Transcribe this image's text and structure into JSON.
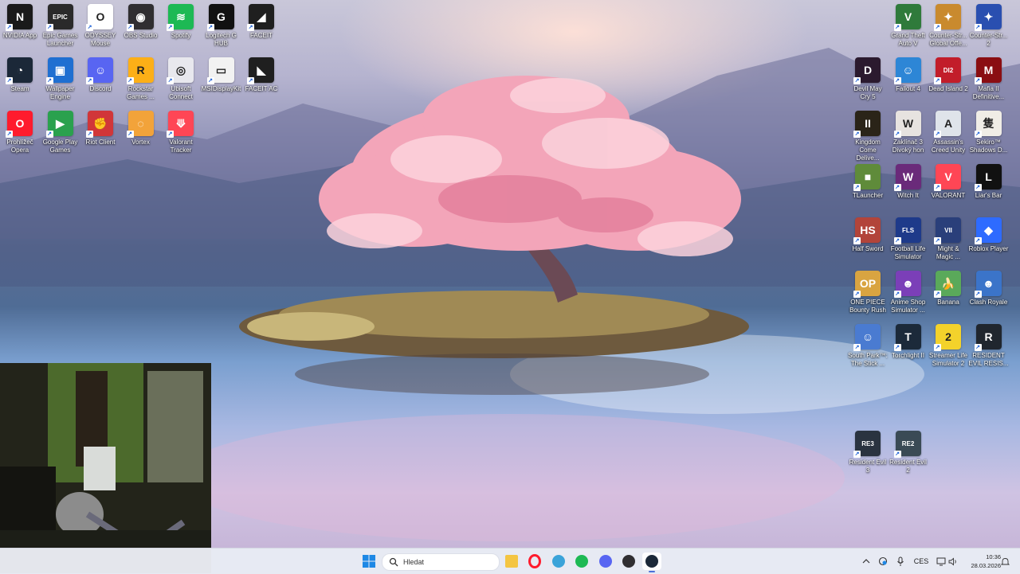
{
  "desktop_icons_left": [
    {
      "label": "NVIDIA App",
      "icon": "nvidia-icon",
      "color": "#1a1a1a",
      "glyph": "N"
    },
    {
      "label": "Epic Games\nLauncher",
      "icon": "epic-games-icon",
      "color": "#2a2a2a",
      "glyph": "EPIC"
    },
    {
      "label": "ODYSSEY\nMouse",
      "icon": "odyssey-mouse-icon",
      "color": "#ffffff",
      "glyph": "O"
    },
    {
      "label": "OBS Studio",
      "icon": "obs-icon",
      "color": "#302e31",
      "glyph": "◉"
    },
    {
      "label": "Spotify",
      "icon": "spotify-icon",
      "color": "#1db954",
      "glyph": "≋"
    },
    {
      "label": "Logitech G\nHUB",
      "icon": "logitech-icon",
      "color": "#111111",
      "glyph": "G"
    },
    {
      "label": "FACEIT",
      "icon": "faceit-icon",
      "color": "#1f1f1f",
      "glyph": "◢"
    },
    {
      "label": "Steam",
      "icon": "steam-icon",
      "color": "#1b2838",
      "glyph": "◔"
    },
    {
      "label": "Wallpaper\nEngine",
      "icon": "wallpaper-engine-icon",
      "color": "#1f6fd1",
      "glyph": "▣"
    },
    {
      "label": "Discord",
      "icon": "discord-icon",
      "color": "#5865f2",
      "glyph": "☺"
    },
    {
      "label": "Rockstar\nGames ...",
      "icon": "rockstar-icon",
      "color": "#fcaf17",
      "glyph": "R"
    },
    {
      "label": "Ubisoft\nConnect",
      "icon": "ubisoft-icon",
      "color": "#e8e8ee",
      "glyph": "◎"
    },
    {
      "label": "MSIDisplayKit",
      "icon": "msi-displaykit-icon",
      "color": "#f2f2f2",
      "glyph": "▭"
    },
    {
      "label": "FACEIT AC",
      "icon": "faceit-ac-icon",
      "color": "#1f1f1f",
      "glyph": "◣"
    },
    {
      "label": "Prohlížeč\nOpera",
      "icon": "opera-icon",
      "color": "#ff1b2d",
      "glyph": "O"
    },
    {
      "label": "Google Play\nGames",
      "icon": "google-play-games-icon",
      "color": "#2aa14e",
      "glyph": "▶"
    },
    {
      "label": "Riot Client",
      "icon": "riot-client-icon",
      "color": "#d13639",
      "glyph": "✊"
    },
    {
      "label": "Vortex",
      "icon": "vortex-icon",
      "color": "#f2a33a",
      "glyph": "◌"
    },
    {
      "label": "Valorant\nTracker",
      "icon": "valorant-tracker-icon",
      "color": "#ff4655",
      "glyph": "⟱"
    }
  ],
  "desktop_icons_right": [
    {
      "label": "Grand Theft\nAuto V",
      "icon": "gta-v-icon",
      "color": "#2f7a3b",
      "glyph": "V"
    },
    {
      "label": "Counter-Str...\nGlobal Offe...",
      "icon": "csgo-icon",
      "color": "#c98a2e",
      "glyph": "✦"
    },
    {
      "label": "Counter-Str...\n2",
      "icon": "cs2-icon",
      "color": "#2a4fb0",
      "glyph": "✦"
    },
    {
      "label": "Devil May\nCry 5",
      "icon": "devil-may-cry-icon",
      "color": "#2b1a2e",
      "glyph": "D"
    },
    {
      "label": "Fallout 4",
      "icon": "fallout-4-icon",
      "color": "#2d86d6",
      "glyph": "☺"
    },
    {
      "label": "Dead Island 2",
      "icon": "dead-island-icon",
      "color": "#c21d2a",
      "glyph": "DI2"
    },
    {
      "label": "Mafia II\nDefinitive...",
      "icon": "mafia-icon",
      "color": "#8a0e12",
      "glyph": "M"
    },
    {
      "label": "Kingdom\nCome Delive...",
      "icon": "kingdom-come-icon",
      "color": "#2a2418",
      "glyph": "II"
    },
    {
      "label": "Zaklínač 3\nDivoký hon",
      "icon": "witcher-3-icon",
      "color": "#e7e3e0",
      "glyph": "W"
    },
    {
      "label": "Assassin's\nCreed Unity",
      "icon": "assassins-creed-icon",
      "color": "#dfe4ea",
      "glyph": "A"
    },
    {
      "label": "Sekiro™\nShadows D...",
      "icon": "sekiro-icon",
      "color": "#f0ede6",
      "glyph": "隻"
    },
    {
      "label": "TLauncher",
      "icon": "tlauncher-icon",
      "color": "#5f8b3a",
      "glyph": "■"
    },
    {
      "label": "Witch It",
      "icon": "witch-it-icon",
      "color": "#6a2a7a",
      "glyph": "W"
    },
    {
      "label": "VALORANT",
      "icon": "valorant-icon",
      "color": "#ff4655",
      "glyph": "V"
    },
    {
      "label": "Liar's Bar",
      "icon": "liars-bar-icon",
      "color": "#111111",
      "glyph": "L"
    },
    {
      "label": "Half Sword",
      "icon": "half-sword-icon",
      "color": "#b2443a",
      "glyph": "HS"
    },
    {
      "label": "Football Life\nSimulator",
      "icon": "football-life-icon",
      "color": "#1e3a8a",
      "glyph": "FLS"
    },
    {
      "label": "Might &\nMagic ...",
      "icon": "might-magic-icon",
      "color": "#2a3f7a",
      "glyph": "VII"
    },
    {
      "label": "Roblox Player",
      "icon": "roblox-icon",
      "color": "#2e6bff",
      "glyph": "◆"
    },
    {
      "label": "ONE PIECE\nBounty Rush",
      "icon": "one-piece-icon",
      "color": "#d9a441",
      "glyph": "OP"
    },
    {
      "label": "Anime Shop\nSimulator ...",
      "icon": "anime-shop-icon",
      "color": "#7b3fb8",
      "glyph": "☻"
    },
    {
      "label": "Banana",
      "icon": "banana-icon",
      "color": "#5aa95a",
      "glyph": "🍌"
    },
    {
      "label": "Clash Royale",
      "icon": "clash-royale-icon",
      "color": "#3b74c9",
      "glyph": "☻"
    },
    {
      "label": "South Park™:\nThe Stick ...",
      "icon": "south-park-icon",
      "color": "#4a7bd1",
      "glyph": "☺"
    },
    {
      "label": "Torchlight II",
      "icon": "torchlight-icon",
      "color": "#1c2a3a",
      "glyph": "T"
    },
    {
      "label": "Streamer Life\nSimulator 2",
      "icon": "streamer-life-icon",
      "color": "#f3d22b",
      "glyph": "2"
    },
    {
      "label": "RESIDENT\nEVIL RESIS...",
      "icon": "resident-evil-resistance-icon",
      "color": "#20262e",
      "glyph": "R"
    },
    {
      "label": "Resident Evil\n3",
      "icon": "resident-evil-3-icon",
      "color": "#2a3340",
      "glyph": "RE3"
    },
    {
      "label": "Resident Evil\n2",
      "icon": "resident-evil-2-icon",
      "color": "#3a4a55",
      "glyph": "RE2"
    }
  ],
  "taskbar": {
    "start_icon": "windows-start-icon",
    "search_placeholder": "Hledat",
    "pinned": [
      {
        "name": "file-explorer",
        "icon": "folder-icon",
        "color": "#f4c542"
      },
      {
        "name": "opera",
        "icon": "opera-icon",
        "color": "#ff1b2d"
      },
      {
        "name": "app-switcher",
        "icon": "pinwheel-icon",
        "color": "#3aa3d9"
      },
      {
        "name": "spotify",
        "icon": "spotify-icon",
        "color": "#1db954"
      },
      {
        "name": "discord",
        "icon": "discord-icon",
        "color": "#5865f2"
      },
      {
        "name": "obs",
        "icon": "obs-icon",
        "color": "#302e31"
      },
      {
        "name": "steam",
        "icon": "steam-icon",
        "color": "#1b2838"
      }
    ],
    "tray": {
      "language": "CES",
      "time": "10:36",
      "date": "28.03.2026"
    }
  },
  "accent_color": "#4a6fd9"
}
